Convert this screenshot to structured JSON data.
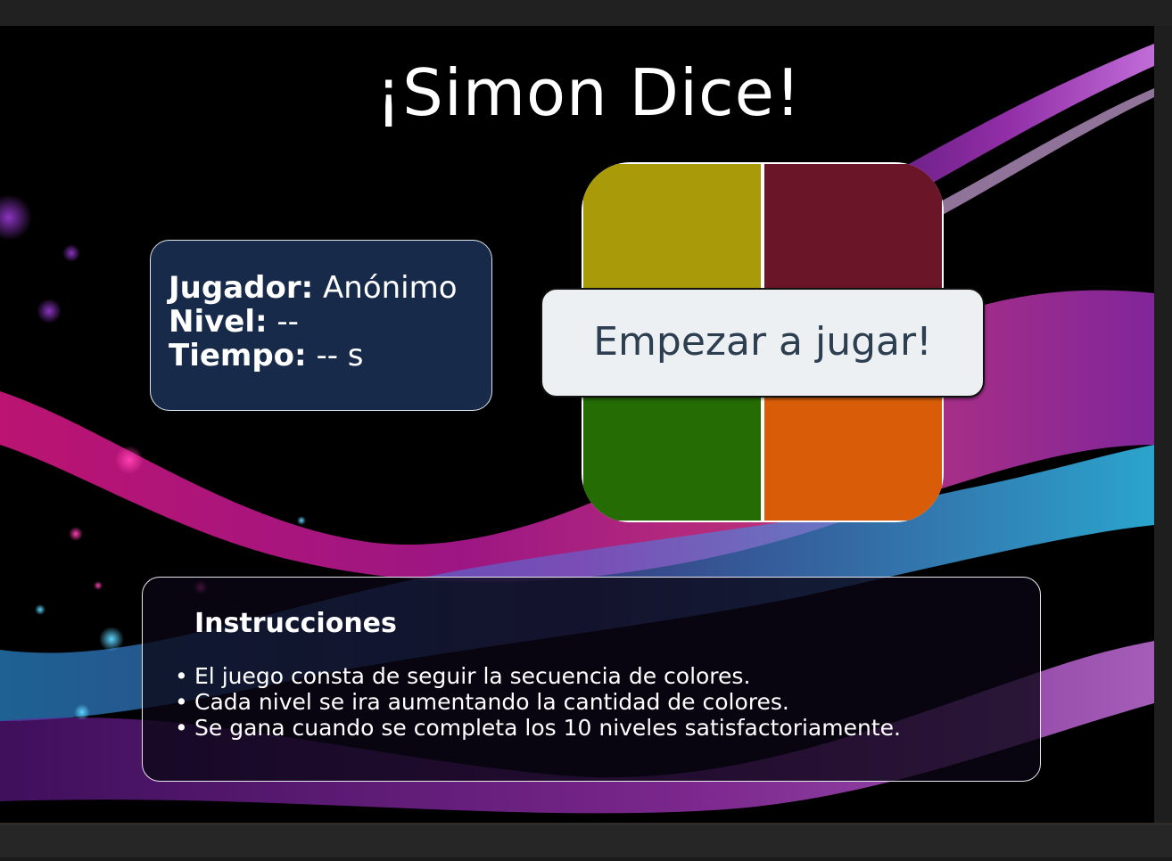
{
  "game": {
    "title": "¡Simon Dice!",
    "start_button": "Empezar a jugar!"
  },
  "status": {
    "player_label": "Jugador:",
    "player_value": "Anónimo",
    "level_label": "Nivel:",
    "level_value": "--",
    "time_label": "Tiempo:",
    "time_value": "-- s"
  },
  "board": {
    "colors": {
      "yellow": "#a89a08",
      "red": "#6b1628",
      "green": "#266c04",
      "orange": "#d95d09"
    }
  },
  "instructions": {
    "heading": "Instrucciones",
    "items": [
      "El juego consta de seguir la secuencia de colores.",
      "Cada nivel se ira aumentando la cantidad de colores.",
      "Se gana cuando se completa los 10 niveles satisfactoriamente."
    ]
  },
  "theme": {
    "info_box_bg": "#172a4a",
    "button_bg": "#edf0f2",
    "button_text": "#2c3e50"
  }
}
